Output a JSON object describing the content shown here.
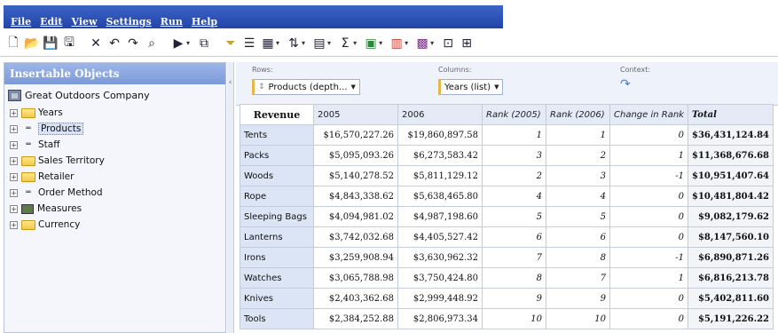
{
  "menu": [
    "File",
    "Edit",
    "View",
    "Settings",
    "Run",
    "Help"
  ],
  "toolbar_icons": [
    "new-icon",
    "open-icon",
    "save-icon",
    "save-as-icon",
    "delete-icon",
    "undo-icon",
    "redo-icon",
    "find-icon",
    "run-icon",
    "explore-icon",
    "filter-icon",
    "suppress-icon",
    "chart-icon",
    "sort-icon",
    "calculation-icon",
    "sum-icon",
    "insert-icon",
    "bar-chart-icon",
    "pie-chart-icon",
    "layout-icon",
    "grid-icon"
  ],
  "left_panel": {
    "title": "Insertable Objects",
    "root": "Great Outdoors Company",
    "items": [
      {
        "label": "Years",
        "kind": "folder",
        "plus": "+"
      },
      {
        "label": "Products",
        "kind": "dimension",
        "plus": "+",
        "selected": true
      },
      {
        "label": "Staff",
        "kind": "dimension",
        "plus": "+"
      },
      {
        "label": "Sales Territory",
        "kind": "folder",
        "plus": "+"
      },
      {
        "label": "Retailer",
        "kind": "folder",
        "plus": "+"
      },
      {
        "label": "Order Method",
        "kind": "dimension",
        "plus": "+"
      },
      {
        "label": "Measures",
        "kind": "measure",
        "plus": "+"
      },
      {
        "label": "Currency",
        "kind": "folder",
        "plus": "+"
      }
    ]
  },
  "collapse_glyph": "‹",
  "dropzones": {
    "rows_label": "Rows:",
    "rows_value": "Products (depth...",
    "columns_label": "Columns:",
    "columns_value": "Years (list)",
    "context_label": "Context:",
    "context_icon": "↷"
  },
  "table": {
    "corner": "Revenue",
    "columns": [
      "2005",
      "2006",
      "Rank (2005)",
      "Rank (2006)",
      "Change in Rank",
      "Total"
    ],
    "rows": [
      {
        "label": "Tents",
        "v2005": "$16,570,227.26",
        "v2006": "$19,860,897.58",
        "r2005": "1",
        "r2006": "1",
        "change": "0",
        "total": "$36,431,124.84"
      },
      {
        "label": "Packs",
        "v2005": "$5,095,093.26",
        "v2006": "$6,273,583.42",
        "r2005": "3",
        "r2006": "2",
        "change": "1",
        "total": "$11,368,676.68"
      },
      {
        "label": "Woods",
        "v2005": "$5,140,278.52",
        "v2006": "$5,811,129.12",
        "r2005": "2",
        "r2006": "3",
        "change": "-1",
        "total": "$10,951,407.64"
      },
      {
        "label": "Rope",
        "v2005": "$4,843,338.62",
        "v2006": "$5,638,465.80",
        "r2005": "4",
        "r2006": "4",
        "change": "0",
        "total": "$10,481,804.42"
      },
      {
        "label": "Sleeping Bags",
        "v2005": "$4,094,981.02",
        "v2006": "$4,987,198.60",
        "r2005": "5",
        "r2006": "5",
        "change": "0",
        "total": "$9,082,179.62"
      },
      {
        "label": "Lanterns",
        "v2005": "$3,742,032.68",
        "v2006": "$4,405,527.42",
        "r2005": "6",
        "r2006": "6",
        "change": "0",
        "total": "$8,147,560.10"
      },
      {
        "label": "Irons",
        "v2005": "$3,259,908.94",
        "v2006": "$3,630,962.32",
        "r2005": "7",
        "r2006": "8",
        "change": "-1",
        "total": "$6,890,871.26"
      },
      {
        "label": "Watches",
        "v2005": "$3,065,788.98",
        "v2006": "$3,750,424.80",
        "r2005": "8",
        "r2006": "7",
        "change": "1",
        "total": "$6,816,213.78"
      },
      {
        "label": "Knives",
        "v2005": "$2,403,362.68",
        "v2006": "$2,999,448.92",
        "r2005": "9",
        "r2006": "9",
        "change": "0",
        "total": "$5,402,811.60"
      },
      {
        "label": "Tools",
        "v2005": "$2,384,252.88",
        "v2006": "$2,806,973.34",
        "r2005": "10",
        "r2006": "10",
        "change": "0",
        "total": "$5,191,226.22"
      }
    ]
  }
}
